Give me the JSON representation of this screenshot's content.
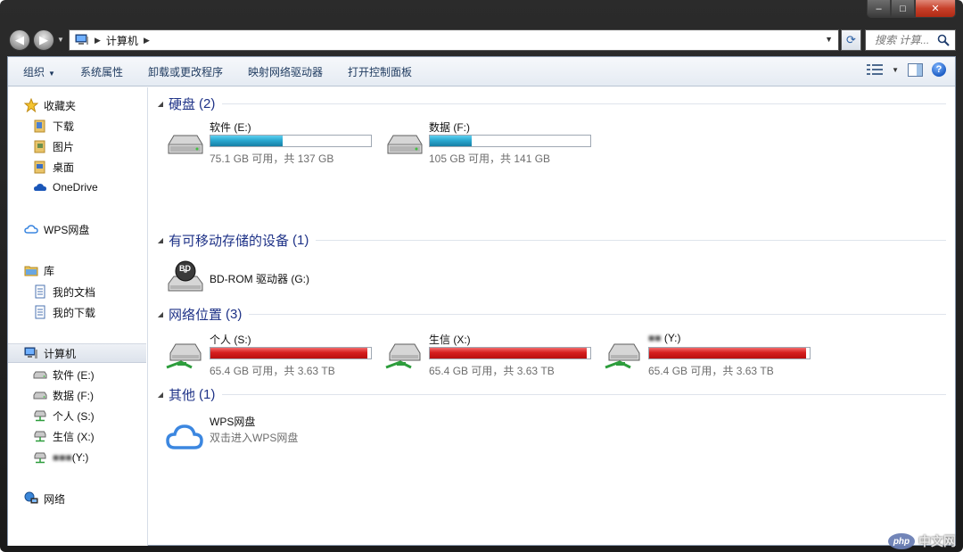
{
  "window": {
    "minimize": "–",
    "maximize": "□",
    "close": "✕"
  },
  "address": {
    "crumb": "计算机",
    "search_placeholder": "搜索 计算..."
  },
  "toolbar": {
    "organize": "组织",
    "system_properties": "系统属性",
    "uninstall": "卸载或更改程序",
    "map_drive": "映射网络驱动器",
    "control_panel": "打开控制面板",
    "help": "?"
  },
  "sidebar": {
    "favorites": "收藏夹",
    "downloads": "下载",
    "pictures": "图片",
    "desktop": "桌面",
    "onedrive": "OneDrive",
    "wps_drive": "WPS网盘",
    "libraries": "库",
    "my_documents": "我的文档",
    "my_downloads": "我的下载",
    "computer": "计算机",
    "drive_e": "软件 (E:)",
    "drive_f": "数据 (F:)",
    "drive_s": "个人 (S:)",
    "drive_x": "生信 (X:)",
    "drive_y_blur": "■■■",
    "drive_y_suffix": "(Y:)",
    "network": "网络"
  },
  "groups": {
    "hdd": {
      "title": "硬盘",
      "count": "(2)"
    },
    "removable": {
      "title": "有可移动存储的设备",
      "count": "(1)"
    },
    "network": {
      "title": "网络位置",
      "count": "(3)"
    },
    "other": {
      "title": "其他",
      "count": "(1)"
    }
  },
  "drives": {
    "e": {
      "name": "软件 (E:)",
      "free": "75.1 GB 可用，共 137 GB",
      "used_fraction": 0.45
    },
    "f": {
      "name": "数据 (F:)",
      "free": "105 GB 可用，共 141 GB",
      "used_fraction": 0.26
    },
    "g": {
      "name": "BD-ROM 驱动器 (G:)",
      "badge": "BD"
    },
    "s": {
      "name": "个人 (S:)",
      "free": "65.4 GB 可用，共 3.63 TB",
      "used_fraction": 0.98
    },
    "x": {
      "name": "生信 (X:)",
      "free": "65.4 GB 可用，共 3.63 TB",
      "used_fraction": 0.98
    },
    "y": {
      "name_blur": "■■",
      "name_suffix": "(Y:)",
      "free": "65.4 GB 可用，共 3.63 TB",
      "used_fraction": 0.98
    }
  },
  "other_items": {
    "wps_name": "WPS网盘",
    "wps_desc": "双击进入WPS网盘"
  },
  "watermark": {
    "logo": "php",
    "text": "中文网"
  },
  "colors": {
    "accent_blue": "#1e3287",
    "bar_blue": "#2aa8d0",
    "bar_red": "#d61e1e"
  }
}
